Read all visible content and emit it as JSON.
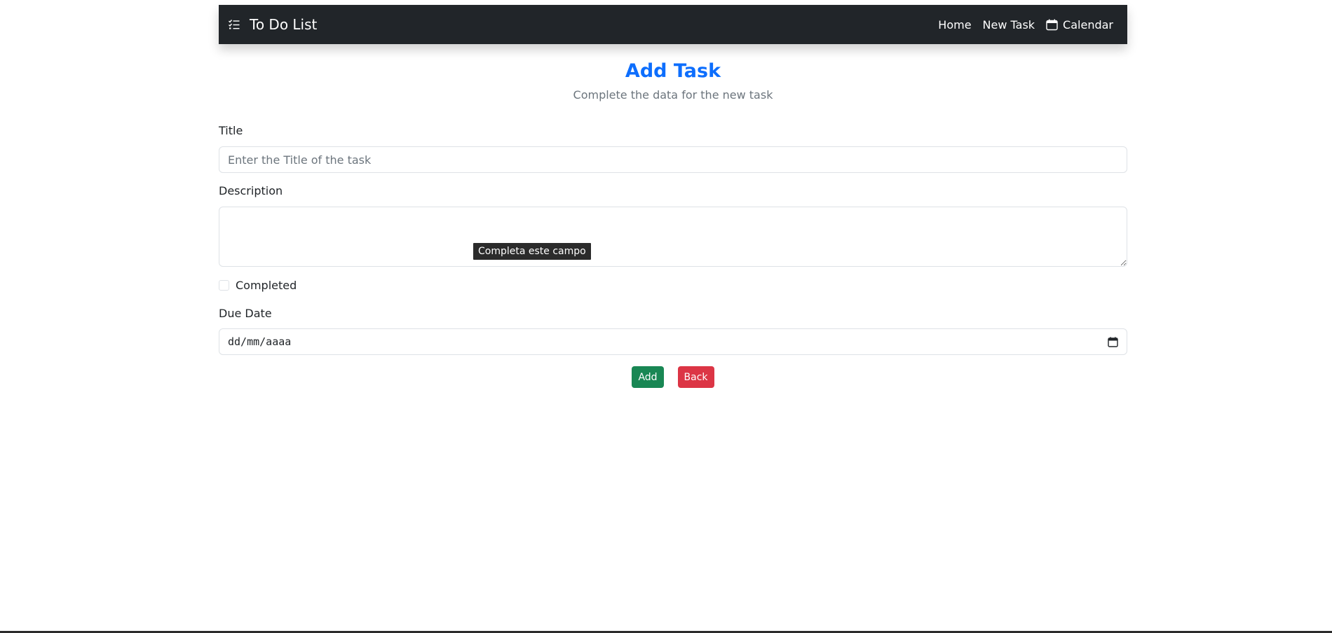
{
  "navbar": {
    "brand": "To Do List",
    "brand_icon": "list-check-icon",
    "links": {
      "home": "Home",
      "new_task": "New Task",
      "calendar": "Calendar"
    },
    "calendar_icon": "calendar-icon"
  },
  "header": {
    "title": "Add Task",
    "subtitle": "Complete the data for the new task"
  },
  "form": {
    "title_label": "Title",
    "title_placeholder": "Enter the Title of the task",
    "title_value": "",
    "description_label": "Description",
    "description_value": "",
    "completed_label": "Completed",
    "completed_checked": false,
    "due_date_label": "Due Date",
    "due_date_value": "dd/mm/aaaa",
    "validation_tooltip": "Completa este campo"
  },
  "buttons": {
    "add": "Add",
    "back": "Back"
  },
  "colors": {
    "navbar_bg": "#212529",
    "title_color": "#0d6efd",
    "add_button": "#198754",
    "back_button": "#dc3545"
  }
}
